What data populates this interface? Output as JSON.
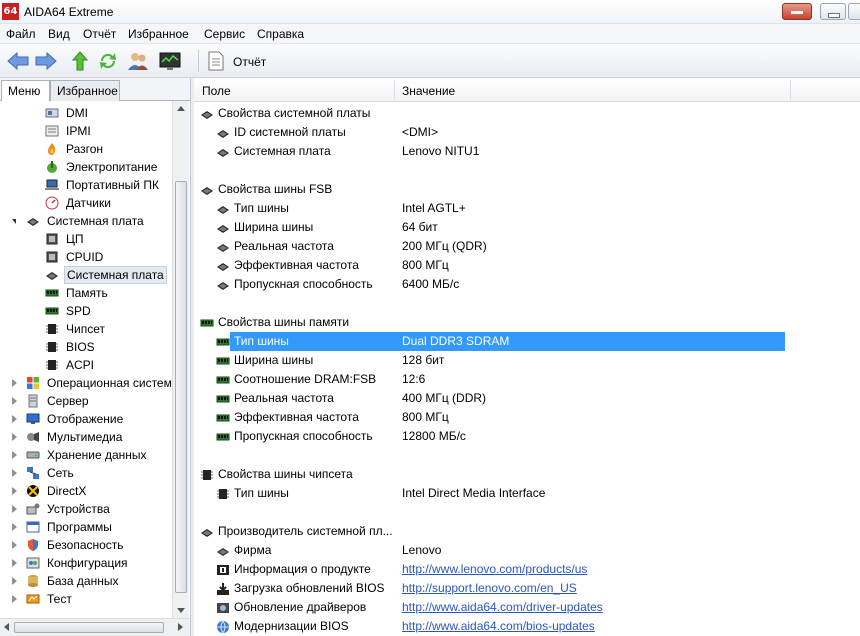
{
  "window": {
    "title": "AIDA64 Extreme",
    "icon_text": "64"
  },
  "menu": [
    "Файл",
    "Вид",
    "Отчёт",
    "Избранное",
    "Сервис",
    "Справка"
  ],
  "toolbar": {
    "report_label": "Отчёт"
  },
  "tabs": {
    "menu": "Меню",
    "favorites": "Избранное"
  },
  "tree": [
    {
      "label": "DMI",
      "indent": 2,
      "icon": "dmi-icon",
      "expander": "none"
    },
    {
      "label": "IPMI",
      "indent": 2,
      "icon": "ipmi-icon",
      "expander": "none"
    },
    {
      "label": "Разгон",
      "indent": 2,
      "icon": "flame-icon",
      "expander": "none"
    },
    {
      "label": "Электропитание",
      "indent": 2,
      "icon": "power-icon",
      "expander": "none"
    },
    {
      "label": "Портативный ПК",
      "indent": 2,
      "icon": "laptop-icon",
      "expander": "none"
    },
    {
      "label": "Датчики",
      "indent": 2,
      "icon": "sensor-icon",
      "expander": "none"
    },
    {
      "label": "Системная плата",
      "indent": 1,
      "icon": "motherboard-icon",
      "expander": "open"
    },
    {
      "label": "ЦП",
      "indent": 2,
      "icon": "cpu-icon",
      "expander": "none"
    },
    {
      "label": "CPUID",
      "indent": 2,
      "icon": "cpu-icon",
      "expander": "none"
    },
    {
      "label": "Системная плата",
      "indent": 2,
      "icon": "motherboard-icon",
      "expander": "none",
      "selected": true
    },
    {
      "label": "Память",
      "indent": 2,
      "icon": "memory-icon",
      "expander": "none"
    },
    {
      "label": "SPD",
      "indent": 2,
      "icon": "memory-icon",
      "expander": "none"
    },
    {
      "label": "Чипсет",
      "indent": 2,
      "icon": "chip-icon",
      "expander": "none"
    },
    {
      "label": "BIOS",
      "indent": 2,
      "icon": "chip-icon",
      "expander": "none"
    },
    {
      "label": "ACPI",
      "indent": 2,
      "icon": "chip-icon",
      "expander": "none"
    },
    {
      "label": "Операционная систем",
      "indent": 1,
      "icon": "windows-icon",
      "expander": "closed"
    },
    {
      "label": "Сервер",
      "indent": 1,
      "icon": "server-icon",
      "expander": "closed"
    },
    {
      "label": "Отображение",
      "indent": 1,
      "icon": "display-icon",
      "expander": "closed"
    },
    {
      "label": "Мультимедиа",
      "indent": 1,
      "icon": "multimedia-icon",
      "expander": "closed"
    },
    {
      "label": "Хранение данных",
      "indent": 1,
      "icon": "storage-icon",
      "expander": "closed"
    },
    {
      "label": "Сеть",
      "indent": 1,
      "icon": "network-icon",
      "expander": "closed"
    },
    {
      "label": "DirectX",
      "indent": 1,
      "icon": "directx-icon",
      "expander": "closed"
    },
    {
      "label": "Устройства",
      "indent": 1,
      "icon": "devices-icon",
      "expander": "closed"
    },
    {
      "label": "Программы",
      "indent": 1,
      "icon": "programs-icon",
      "expander": "closed"
    },
    {
      "label": "Безопасность",
      "indent": 1,
      "icon": "shield-icon",
      "expander": "closed"
    },
    {
      "label": "Конфигурация",
      "indent": 1,
      "icon": "config-icon",
      "expander": "closed"
    },
    {
      "label": "База данных",
      "indent": 1,
      "icon": "database-icon",
      "expander": "closed"
    },
    {
      "label": "Тест",
      "indent": 1,
      "icon": "test-icon",
      "expander": "closed"
    }
  ],
  "columns": {
    "field": "Поле",
    "value": "Значение"
  },
  "rows": [
    {
      "kind": "group",
      "field": "Свойства системной платы",
      "icon": "motherboard-icon"
    },
    {
      "kind": "item",
      "field": "ID системной платы",
      "value": "<DMI>",
      "icon": "motherboard-icon"
    },
    {
      "kind": "item",
      "field": "Системная плата",
      "value": "Lenovo NITU1",
      "icon": "motherboard-icon"
    },
    {
      "kind": "gap"
    },
    {
      "kind": "group",
      "field": "Свойства шины FSB",
      "icon": "motherboard-icon"
    },
    {
      "kind": "item",
      "field": "Тип шины",
      "value": "Intel AGTL+",
      "icon": "motherboard-icon"
    },
    {
      "kind": "item",
      "field": "Ширина шины",
      "value": "64 бит",
      "icon": "motherboard-icon"
    },
    {
      "kind": "item",
      "field": "Реальная частота",
      "value": "200 МГц (QDR)",
      "icon": "motherboard-icon"
    },
    {
      "kind": "item",
      "field": "Эффективная частота",
      "value": "800 МГц",
      "icon": "motherboard-icon"
    },
    {
      "kind": "item",
      "field": "Пропускная способность",
      "value": "6400 МБ/с",
      "icon": "motherboard-icon"
    },
    {
      "kind": "gap"
    },
    {
      "kind": "group",
      "field": "Свойства шины памяти",
      "icon": "memory-icon"
    },
    {
      "kind": "item",
      "field": "Тип шины",
      "value": "Dual DDR3 SDRAM",
      "icon": "memory-icon",
      "highlight": true
    },
    {
      "kind": "item",
      "field": "Ширина шины",
      "value": "128 бит",
      "icon": "memory-icon"
    },
    {
      "kind": "item",
      "field": "Соотношение DRAM:FSB",
      "value": "12:6",
      "icon": "memory-icon"
    },
    {
      "kind": "item",
      "field": "Реальная частота",
      "value": "400 МГц (DDR)",
      "icon": "memory-icon"
    },
    {
      "kind": "item",
      "field": "Эффективная частота",
      "value": "800 МГц",
      "icon": "memory-icon"
    },
    {
      "kind": "item",
      "field": "Пропускная способность",
      "value": "12800 МБ/с",
      "icon": "memory-icon"
    },
    {
      "kind": "gap"
    },
    {
      "kind": "group",
      "field": "Свойства шины чипсета",
      "icon": "chip-icon"
    },
    {
      "kind": "item",
      "field": "Тип шины",
      "value": "Intel Direct Media Interface",
      "icon": "chip-icon"
    },
    {
      "kind": "gap"
    },
    {
      "kind": "group",
      "field": "Производитель системной пл...",
      "icon": "motherboard-icon"
    },
    {
      "kind": "item",
      "field": "Фирма",
      "value": "Lenovo",
      "icon": "motherboard-icon"
    },
    {
      "kind": "item",
      "field": "Информация о продукте",
      "value": "http://www.lenovo.com/products/us",
      "icon": "info-icon",
      "link": true
    },
    {
      "kind": "item",
      "field": "Загрузка обновлений BIOS",
      "value": "http://support.lenovo.com/en_US",
      "icon": "download-icon",
      "link": true
    },
    {
      "kind": "item",
      "field": "Обновление драйверов",
      "value": "http://www.aida64.com/driver-updates",
      "icon": "driver-icon",
      "link": true
    },
    {
      "kind": "item",
      "field": "Модернизации BIOS",
      "value": "http://www.aida64.com/bios-updates",
      "icon": "globe-icon",
      "link": true
    }
  ],
  "colors": {
    "selection": "#3399ff",
    "link": "#2b55c4",
    "close_button": "#c8442e"
  }
}
